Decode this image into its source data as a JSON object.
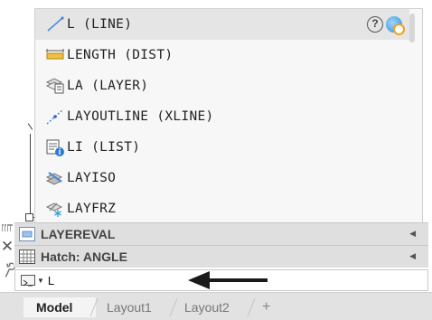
{
  "autocomplete": {
    "items": [
      {
        "label": "L (LINE)",
        "icon": "line-icon",
        "selected": true
      },
      {
        "label": "LENGTH (DIST)",
        "icon": "measure-icon"
      },
      {
        "label": "LA (LAYER)",
        "icon": "layer-properties-icon"
      },
      {
        "label": "LAYOUTLINE (XLINE)",
        "icon": "construction-line-icon"
      },
      {
        "label": "LI (LIST)",
        "icon": "list-info-icon"
      },
      {
        "label": "LAYISO",
        "icon": "layer-isolate-icon"
      },
      {
        "label": "LAYFRZ",
        "icon": "layer-freeze-icon"
      }
    ],
    "help_glyph": "?"
  },
  "history": [
    {
      "label": "LAYEREVAL",
      "icon": "layer-evaluate-icon"
    },
    {
      "label": "Hatch: ANGLE",
      "icon": "hatch-icon"
    }
  ],
  "command_line": {
    "value": "L",
    "caret_glyph": "▼"
  },
  "gutter": {
    "close_glyph": "✕"
  },
  "tabs": [
    {
      "label": "Model",
      "active": true
    },
    {
      "label": "Layout1"
    },
    {
      "label": "Layout2"
    }
  ],
  "add_tab_glyph": "+",
  "colors": {
    "popup_bg": "#f7f7f7",
    "selected_row": "#e5e5e5",
    "history_bg": "#dfdfdf",
    "tabbar_bg": "#e2e2e2"
  }
}
